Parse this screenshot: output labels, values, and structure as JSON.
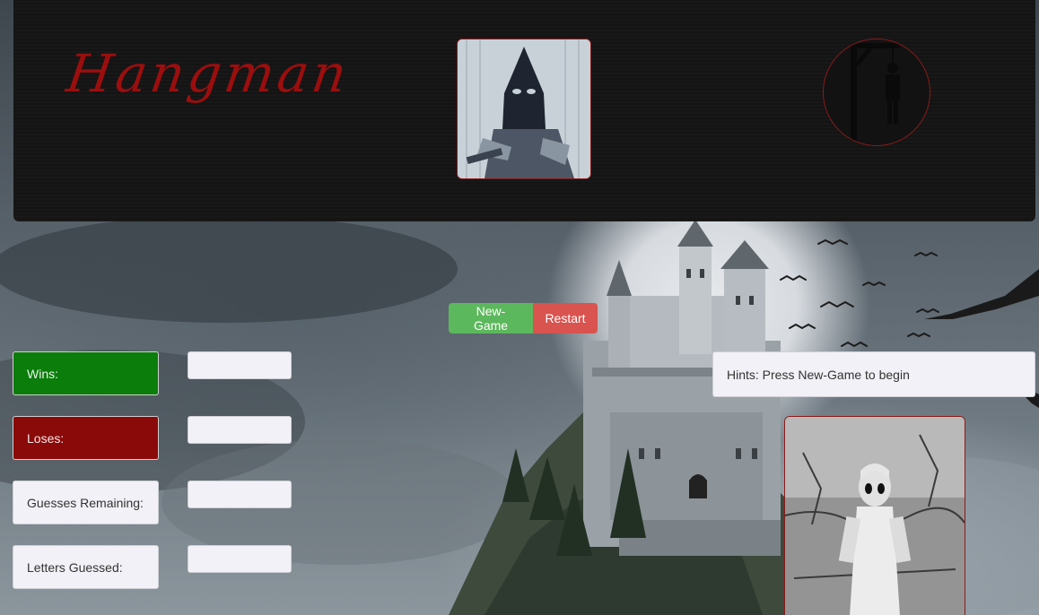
{
  "header": {
    "title": "Hangman",
    "executioner_image": "executioner-engraving",
    "logo_icon": "gallows-icon"
  },
  "controls": {
    "new_game_label": "New-Game",
    "restart_label": "Restart"
  },
  "stats": {
    "wins_label": "Wins:",
    "wins_value": "",
    "loses_label": "Loses:",
    "loses_value": "",
    "guesses_label": "Guesses Remaining:",
    "guesses_value": "",
    "letters_label": "Letters Guessed:",
    "letters_value": ""
  },
  "hints": {
    "text": "Hints: Press New-Game to begin"
  },
  "images": {
    "ghost_image": "ghost-girl-photo",
    "background": "haunted-castle-moon"
  },
  "colors": {
    "title": "#9b0e0e",
    "wins_bg": "#0b7d0b",
    "loses_bg": "#8a0a0a",
    "new_game_bg": "#5cb85c",
    "restart_bg": "#d9534f",
    "frame_border": "#8b1a1a"
  }
}
